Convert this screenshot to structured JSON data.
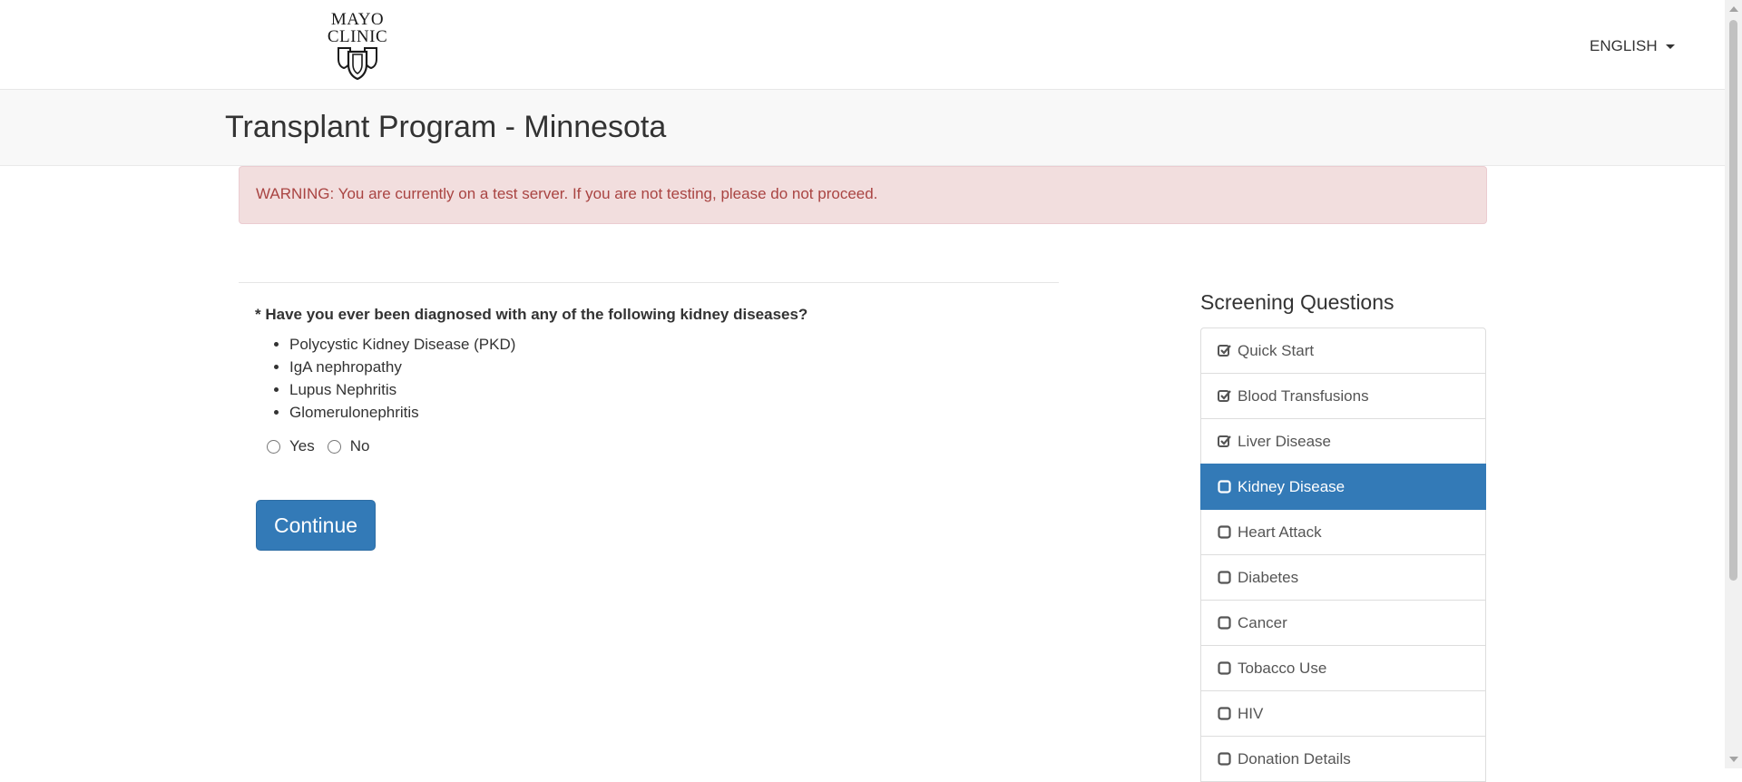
{
  "brand": {
    "logo_line1": "MAYO",
    "logo_line2": "CLINIC"
  },
  "nav": {
    "language": "ENGLISH"
  },
  "page": {
    "title": "Transplant Program - Minnesota"
  },
  "alert": {
    "text": "WARNING: You are currently on a test server. If you are not testing, please do not proceed."
  },
  "question": {
    "text": "* Have you ever been diagnosed with any of the following kidney diseases?",
    "options": [
      "Polycystic Kidney Disease (PKD)",
      "IgA nephropathy",
      "Lupus Nephritis",
      "Glomerulonephritis"
    ],
    "answers": [
      "Yes",
      "No"
    ],
    "continue_label": "Continue"
  },
  "sidebar": {
    "title": "Screening Questions",
    "items": [
      {
        "label": "Quick Start",
        "state": "checked"
      },
      {
        "label": "Blood Transfusions",
        "state": "checked"
      },
      {
        "label": "Liver Disease",
        "state": "checked"
      },
      {
        "label": "Kidney Disease",
        "state": "active"
      },
      {
        "label": "Heart Attack",
        "state": "unchecked"
      },
      {
        "label": "Diabetes",
        "state": "unchecked"
      },
      {
        "label": "Cancer",
        "state": "unchecked"
      },
      {
        "label": "Tobacco Use",
        "state": "unchecked"
      },
      {
        "label": "HIV",
        "state": "unchecked"
      },
      {
        "label": "Donation Details",
        "state": "unchecked"
      }
    ]
  },
  "colors": {
    "primary": "#337ab7",
    "alert_bg": "#f2dede",
    "alert_text": "#a94442",
    "titlebar_bg": "#f8f8f8"
  },
  "icons": {
    "checked": "check-square-icon",
    "unchecked": "empty-square-icon",
    "language_dropdown": "caret-down-icon"
  }
}
